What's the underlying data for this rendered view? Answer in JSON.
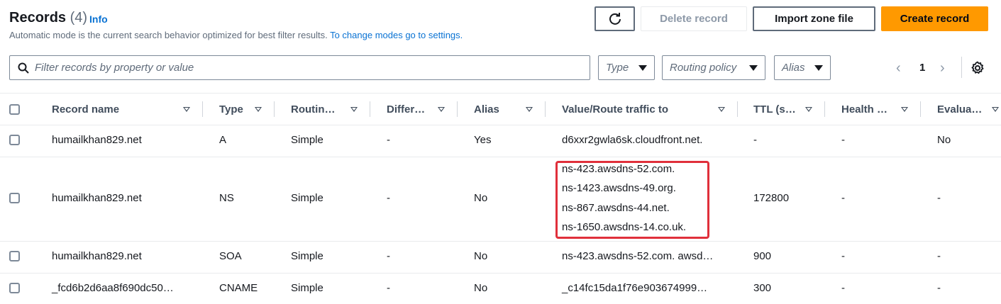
{
  "header": {
    "title": "Records",
    "count": "(4)",
    "info": "Info",
    "description": "Automatic mode is the current search behavior optimized for best filter results.",
    "description_link": "To change modes go to settings."
  },
  "actions": {
    "delete_label": "Delete record",
    "import_label": "Import zone file",
    "create_label": "Create record"
  },
  "filters": {
    "search_placeholder": "Filter records by property or value",
    "type_label": "Type",
    "routing_label": "Routing policy",
    "alias_label": "Alias"
  },
  "pagination": {
    "prev": "‹",
    "page": "1",
    "next": "›"
  },
  "columns": [
    "Record name",
    "Type",
    "Routin…",
    "Differ…",
    "Alias",
    "Value/Route traffic to",
    "TTL (s…",
    "Health …",
    "Evalua…"
  ],
  "rows": [
    {
      "name": "humailkhan829.net",
      "type": "A",
      "routing": "Simple",
      "differ": "-",
      "alias": "Yes",
      "value": [
        "d6xxr2gwla6sk.cloudfront.net."
      ],
      "ttl": "-",
      "health": "-",
      "evaluate": "No"
    },
    {
      "name": "humailkhan829.net",
      "type": "NS",
      "routing": "Simple",
      "differ": "-",
      "alias": "No",
      "value": [
        "ns-423.awsdns-52.com.",
        "ns-1423.awsdns-49.org.",
        "ns-867.awsdns-44.net.",
        "ns-1650.awsdns-14.co.uk."
      ],
      "ttl": "172800",
      "health": "-",
      "evaluate": "-"
    },
    {
      "name": "humailkhan829.net",
      "type": "SOA",
      "routing": "Simple",
      "differ": "-",
      "alias": "No",
      "value": [
        "ns-423.awsdns-52.com. awsd…"
      ],
      "ttl": "900",
      "health": "-",
      "evaluate": "-"
    },
    {
      "name": "_fcd6b2d6aa8f690dc50…",
      "type": "CNAME",
      "routing": "Simple",
      "differ": "-",
      "alias": "No",
      "value": [
        "_c14fc15da1f76e903674999…"
      ],
      "ttl": "300",
      "health": "-",
      "evaluate": "-"
    }
  ],
  "colors": {
    "accent": "#ff9900",
    "link": "#0972d3",
    "highlight": "#e0303b"
  }
}
